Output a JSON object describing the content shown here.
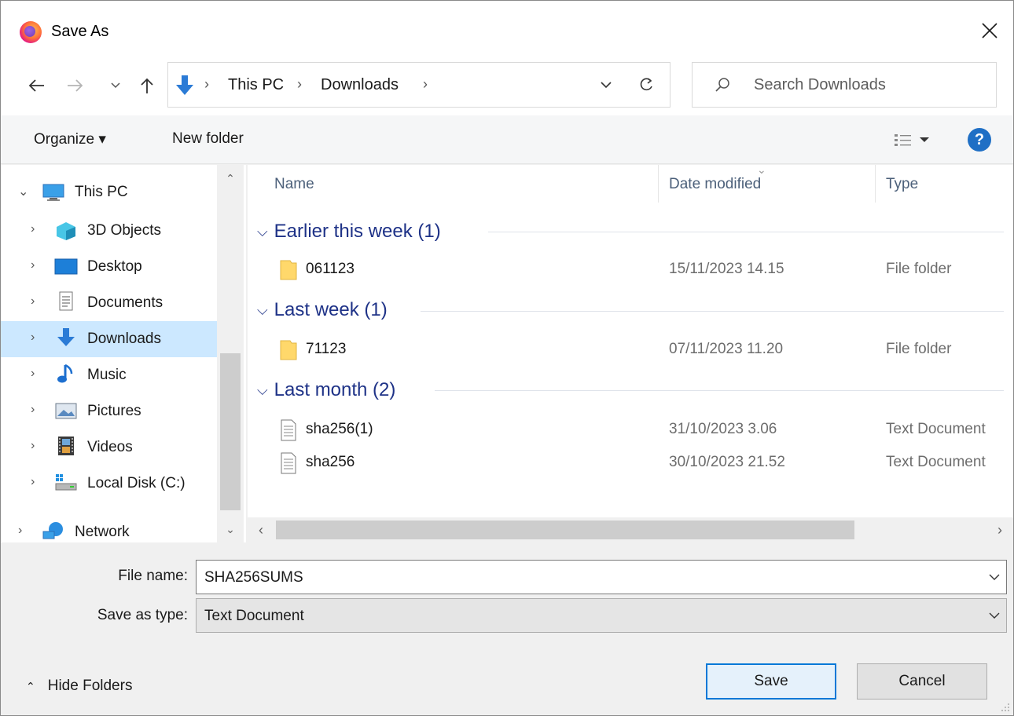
{
  "window": {
    "title": "Save As"
  },
  "nav": {
    "breadcrumbs": [
      "This PC",
      "Downloads"
    ],
    "search_placeholder": "Search Downloads"
  },
  "toolbar": {
    "organize_label": "Organize ▾",
    "new_folder_label": "New folder",
    "help_label": "?"
  },
  "tree": {
    "items": [
      {
        "label": "This PC",
        "icon": "computer-icon",
        "expanded": true
      },
      {
        "label": "3D Objects",
        "icon": "3d-objects-icon"
      },
      {
        "label": "Desktop",
        "icon": "desktop-icon"
      },
      {
        "label": "Documents",
        "icon": "documents-icon"
      },
      {
        "label": "Downloads",
        "icon": "downloads-icon",
        "selected": true
      },
      {
        "label": "Music",
        "icon": "music-icon"
      },
      {
        "label": "Pictures",
        "icon": "pictures-icon"
      },
      {
        "label": "Videos",
        "icon": "videos-icon"
      },
      {
        "label": "Local Disk (C:)",
        "icon": "local-disk-icon"
      },
      {
        "label": "Network",
        "icon": "network-icon"
      }
    ]
  },
  "columns": {
    "name": "Name",
    "date": "Date modified",
    "type": "Type"
  },
  "groups": [
    {
      "label": "Earlier this week (1)",
      "files": [
        {
          "name": "061123",
          "date": "15/11/2023 14.15",
          "type": "File folder",
          "icon": "folder-icon"
        }
      ]
    },
    {
      "label": "Last week (1)",
      "files": [
        {
          "name": "71123",
          "date": "07/11/2023 11.20",
          "type": "File folder",
          "icon": "folder-icon"
        }
      ]
    },
    {
      "label": "Last month (2)",
      "files": [
        {
          "name": "sha256(1)",
          "date": "31/10/2023 3.06",
          "type": "Text Document",
          "icon": "text-document-icon"
        },
        {
          "name": "sha256",
          "date": "30/10/2023 21.52",
          "type": "Text Document",
          "icon": "text-document-icon"
        }
      ]
    }
  ],
  "form": {
    "file_name_label": "File name:",
    "file_name_value": "SHA256SUMS",
    "save_type_label": "Save as type:",
    "save_type_value": "Text Document"
  },
  "footer": {
    "hide_folders_label": "Hide Folders",
    "save_label": "Save",
    "cancel_label": "Cancel"
  },
  "colors": {
    "accent": "#0078d7",
    "selection": "#cce8ff",
    "group_heading": "#1e3287"
  }
}
